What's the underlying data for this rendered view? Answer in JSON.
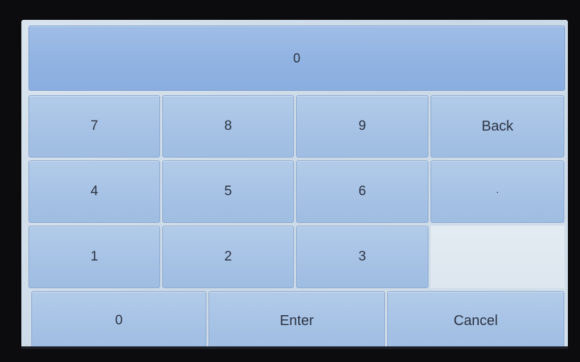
{
  "display": {
    "value": "0"
  },
  "keys": {
    "k7": "7",
    "k8": "8",
    "k9": "9",
    "back": "Back",
    "k4": "4",
    "k5": "5",
    "k6": "6",
    "dot": "·",
    "k1": "1",
    "k2": "2",
    "k3": "3",
    "k0": "0",
    "enter": "Enter",
    "cancel": "Cancel"
  },
  "colors": {
    "display_bg": "#90b2e2",
    "key_bg": "#a6c2e5",
    "screen_bg": "#d3dfea",
    "text": "#2c3342"
  }
}
